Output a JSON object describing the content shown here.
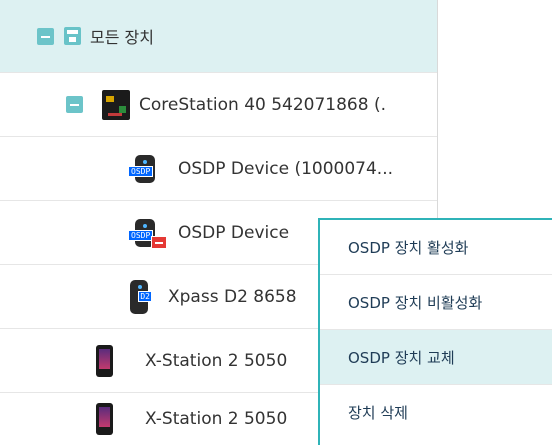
{
  "tree": {
    "root": {
      "label": "모든 장치"
    },
    "items": [
      {
        "label": "CoreStation 40 542071868 (.",
        "type": "corestation"
      },
      {
        "label": "OSDP Device (1000074...",
        "type": "osdp",
        "badge": "OSDP"
      },
      {
        "label": "OSDP Device",
        "type": "osdp-disabled",
        "badge": "OSDP"
      },
      {
        "label": "Xpass D2 8658",
        "type": "xpass",
        "badge": "D2"
      },
      {
        "label": "X-Station 2 5050",
        "type": "xstation"
      },
      {
        "label": "X-Station 2 5050",
        "type": "xstation"
      }
    ]
  },
  "context_menu": {
    "items": [
      {
        "label": "OSDP 장치 활성화"
      },
      {
        "label": "OSDP 장치 비활성화"
      },
      {
        "label": "OSDP 장치 교체"
      },
      {
        "label": "장치 삭제"
      }
    ],
    "highlighted_index": 2
  },
  "colors": {
    "accent": "#2fb3b8",
    "selected_bg": "#ddf1f2",
    "badge_blue": "#0066ff",
    "remove_red": "#e53935"
  }
}
